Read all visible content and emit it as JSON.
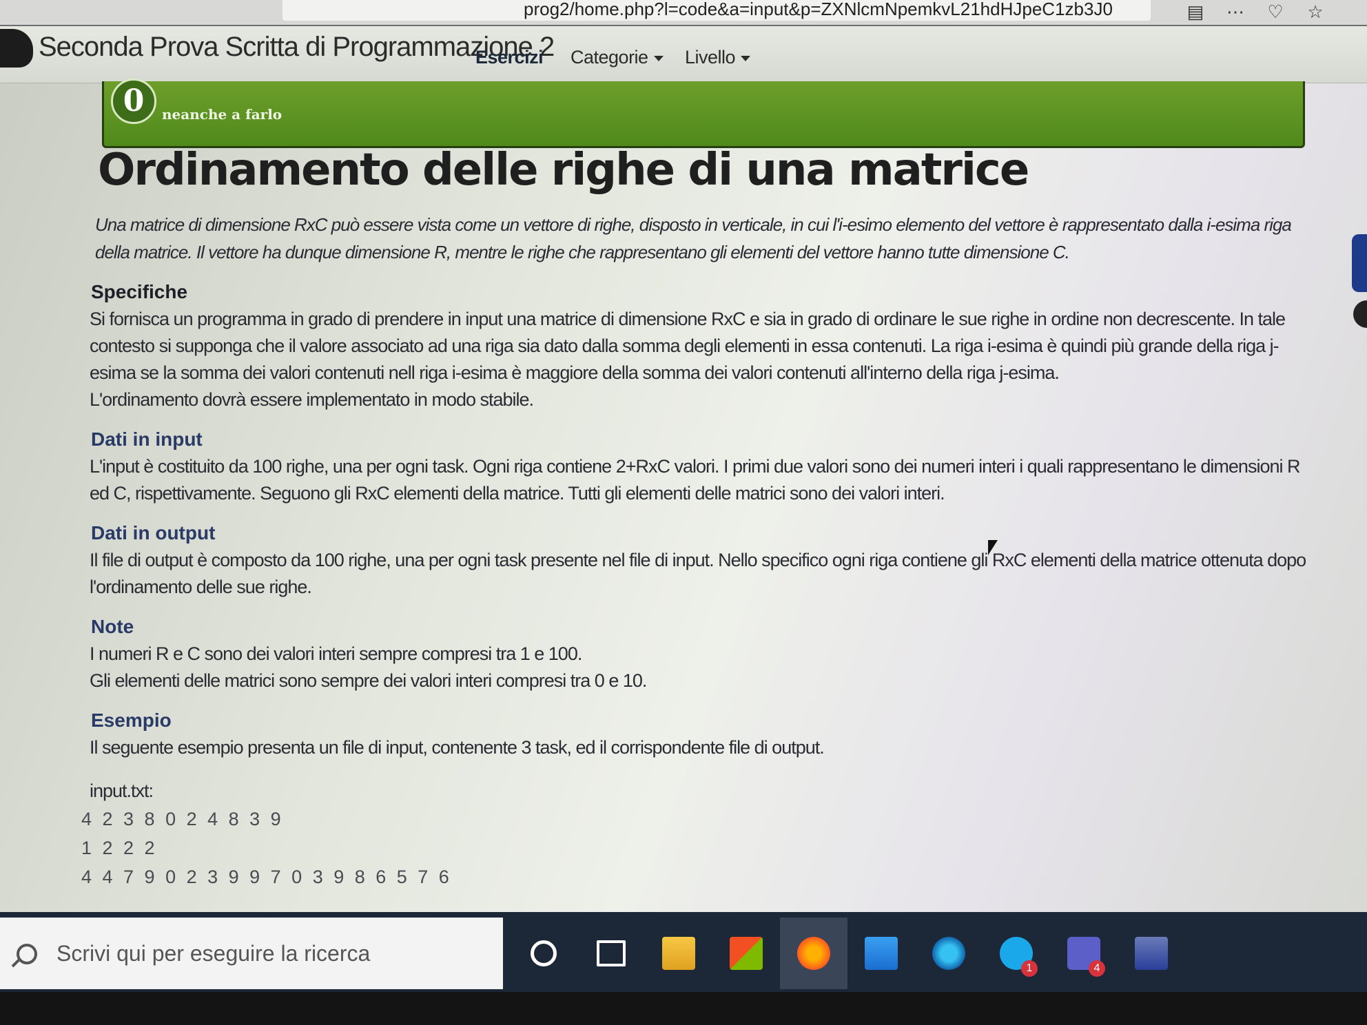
{
  "browser": {
    "url": "prog2/home.php?l=code&a=input&p=ZXNlcmNpemkvL21hdHJpeC1zb3J0",
    "toolbar_icons": [
      "reader-icon",
      "more-icon",
      "pocket-icon",
      "star-icon"
    ]
  },
  "navbar": {
    "site_title": "Seconda Prova Scritta di Programmazione 2",
    "links": [
      "Esercizi",
      "Categorie",
      "Livello"
    ]
  },
  "level": {
    "number": "0",
    "label": "neanche a farlo"
  },
  "exercise": {
    "title": "Ordinamento delle righe di una matrice",
    "intro": "Una matrice di dimensione RxC può essere vista come un vettore di righe, disposto in verticale, in cui l'i-esimo elemento del vettore è rappresentato dalla i-esima riga della matrice. Il vettore ha dunque dimensione R, mentre le righe che rappresentano gli elementi del vettore hanno tutte dimensione C.",
    "sections": {
      "specifiche": {
        "heading": "Specifiche",
        "text1": "Si fornisca un programma in grado di prendere in input una matrice di dimensione RxC e sia in grado di ordinare le sue righe in ordine non decrescente. In tale contesto si supponga che il valore associato ad una riga sia dato dalla somma degli elementi in essa contenuti. La riga i-esima è quindi più grande della riga j-esima se la somma dei valori contenuti nell riga i-esima è maggiore della somma dei valori contenuti all'interno della riga j-esima.",
        "text2": "L'ordinamento dovrà essere implementato in modo stabile."
      },
      "input": {
        "heading": "Dati in input",
        "text": "L'input è costituito da 100 righe, una per ogni task. Ogni riga contiene 2+RxC valori. I primi due valori sono dei numeri interi i quali rappresentano le dimensioni R ed C, rispettivamente. Seguono gli RxC elementi della matrice. Tutti gli elementi delle matrici sono dei valori interi."
      },
      "output": {
        "heading": "Dati in output",
        "text": "Il file di output è composto da 100 righe, una per ogni task presente nel file di input. Nello specifico ogni riga contiene gli RxC elementi della matrice ottenuta dopo l'ordinamento delle sue righe."
      },
      "note": {
        "heading": "Note",
        "line1": "I numeri R e C sono dei valori interi sempre compresi tra 1 e 100.",
        "line2": "Gli elementi delle matrici sono sempre dei valori interi compresi tra 0 e 10."
      },
      "esempio": {
        "heading": "Esempio",
        "text": "Il seguente esempio presenta un file di input, contenente 3 task, ed il corrispondente file di output.",
        "file_label": "input.txt:",
        "lines": [
          "4 2 3 8 0 2 4 8 3 9",
          "1 2 2 2",
          "4 4 7 9 0 2 3 9 9 7 0 3 9 8 6 5 7 6"
        ]
      }
    }
  },
  "taskbar": {
    "search_placeholder": "Scrivi qui per eseguire la ricerca",
    "apps": [
      {
        "name": "cortana-icon",
        "badge": ""
      },
      {
        "name": "task-view-icon",
        "badge": ""
      },
      {
        "name": "file-explorer-icon",
        "badge": ""
      },
      {
        "name": "store-icon",
        "badge": ""
      },
      {
        "name": "firefox-icon",
        "badge": ""
      },
      {
        "name": "mail-icon",
        "badge": ""
      },
      {
        "name": "edge-icon",
        "badge": ""
      },
      {
        "name": "skype-icon",
        "badge": "1"
      },
      {
        "name": "teams-icon",
        "badge": "4"
      },
      {
        "name": "devc-icon",
        "badge": ""
      }
    ]
  },
  "colors": {
    "level_green": "#4f8a1c",
    "heading_blue": "#2a3a66",
    "taskbar_bg": "#1c2738"
  }
}
